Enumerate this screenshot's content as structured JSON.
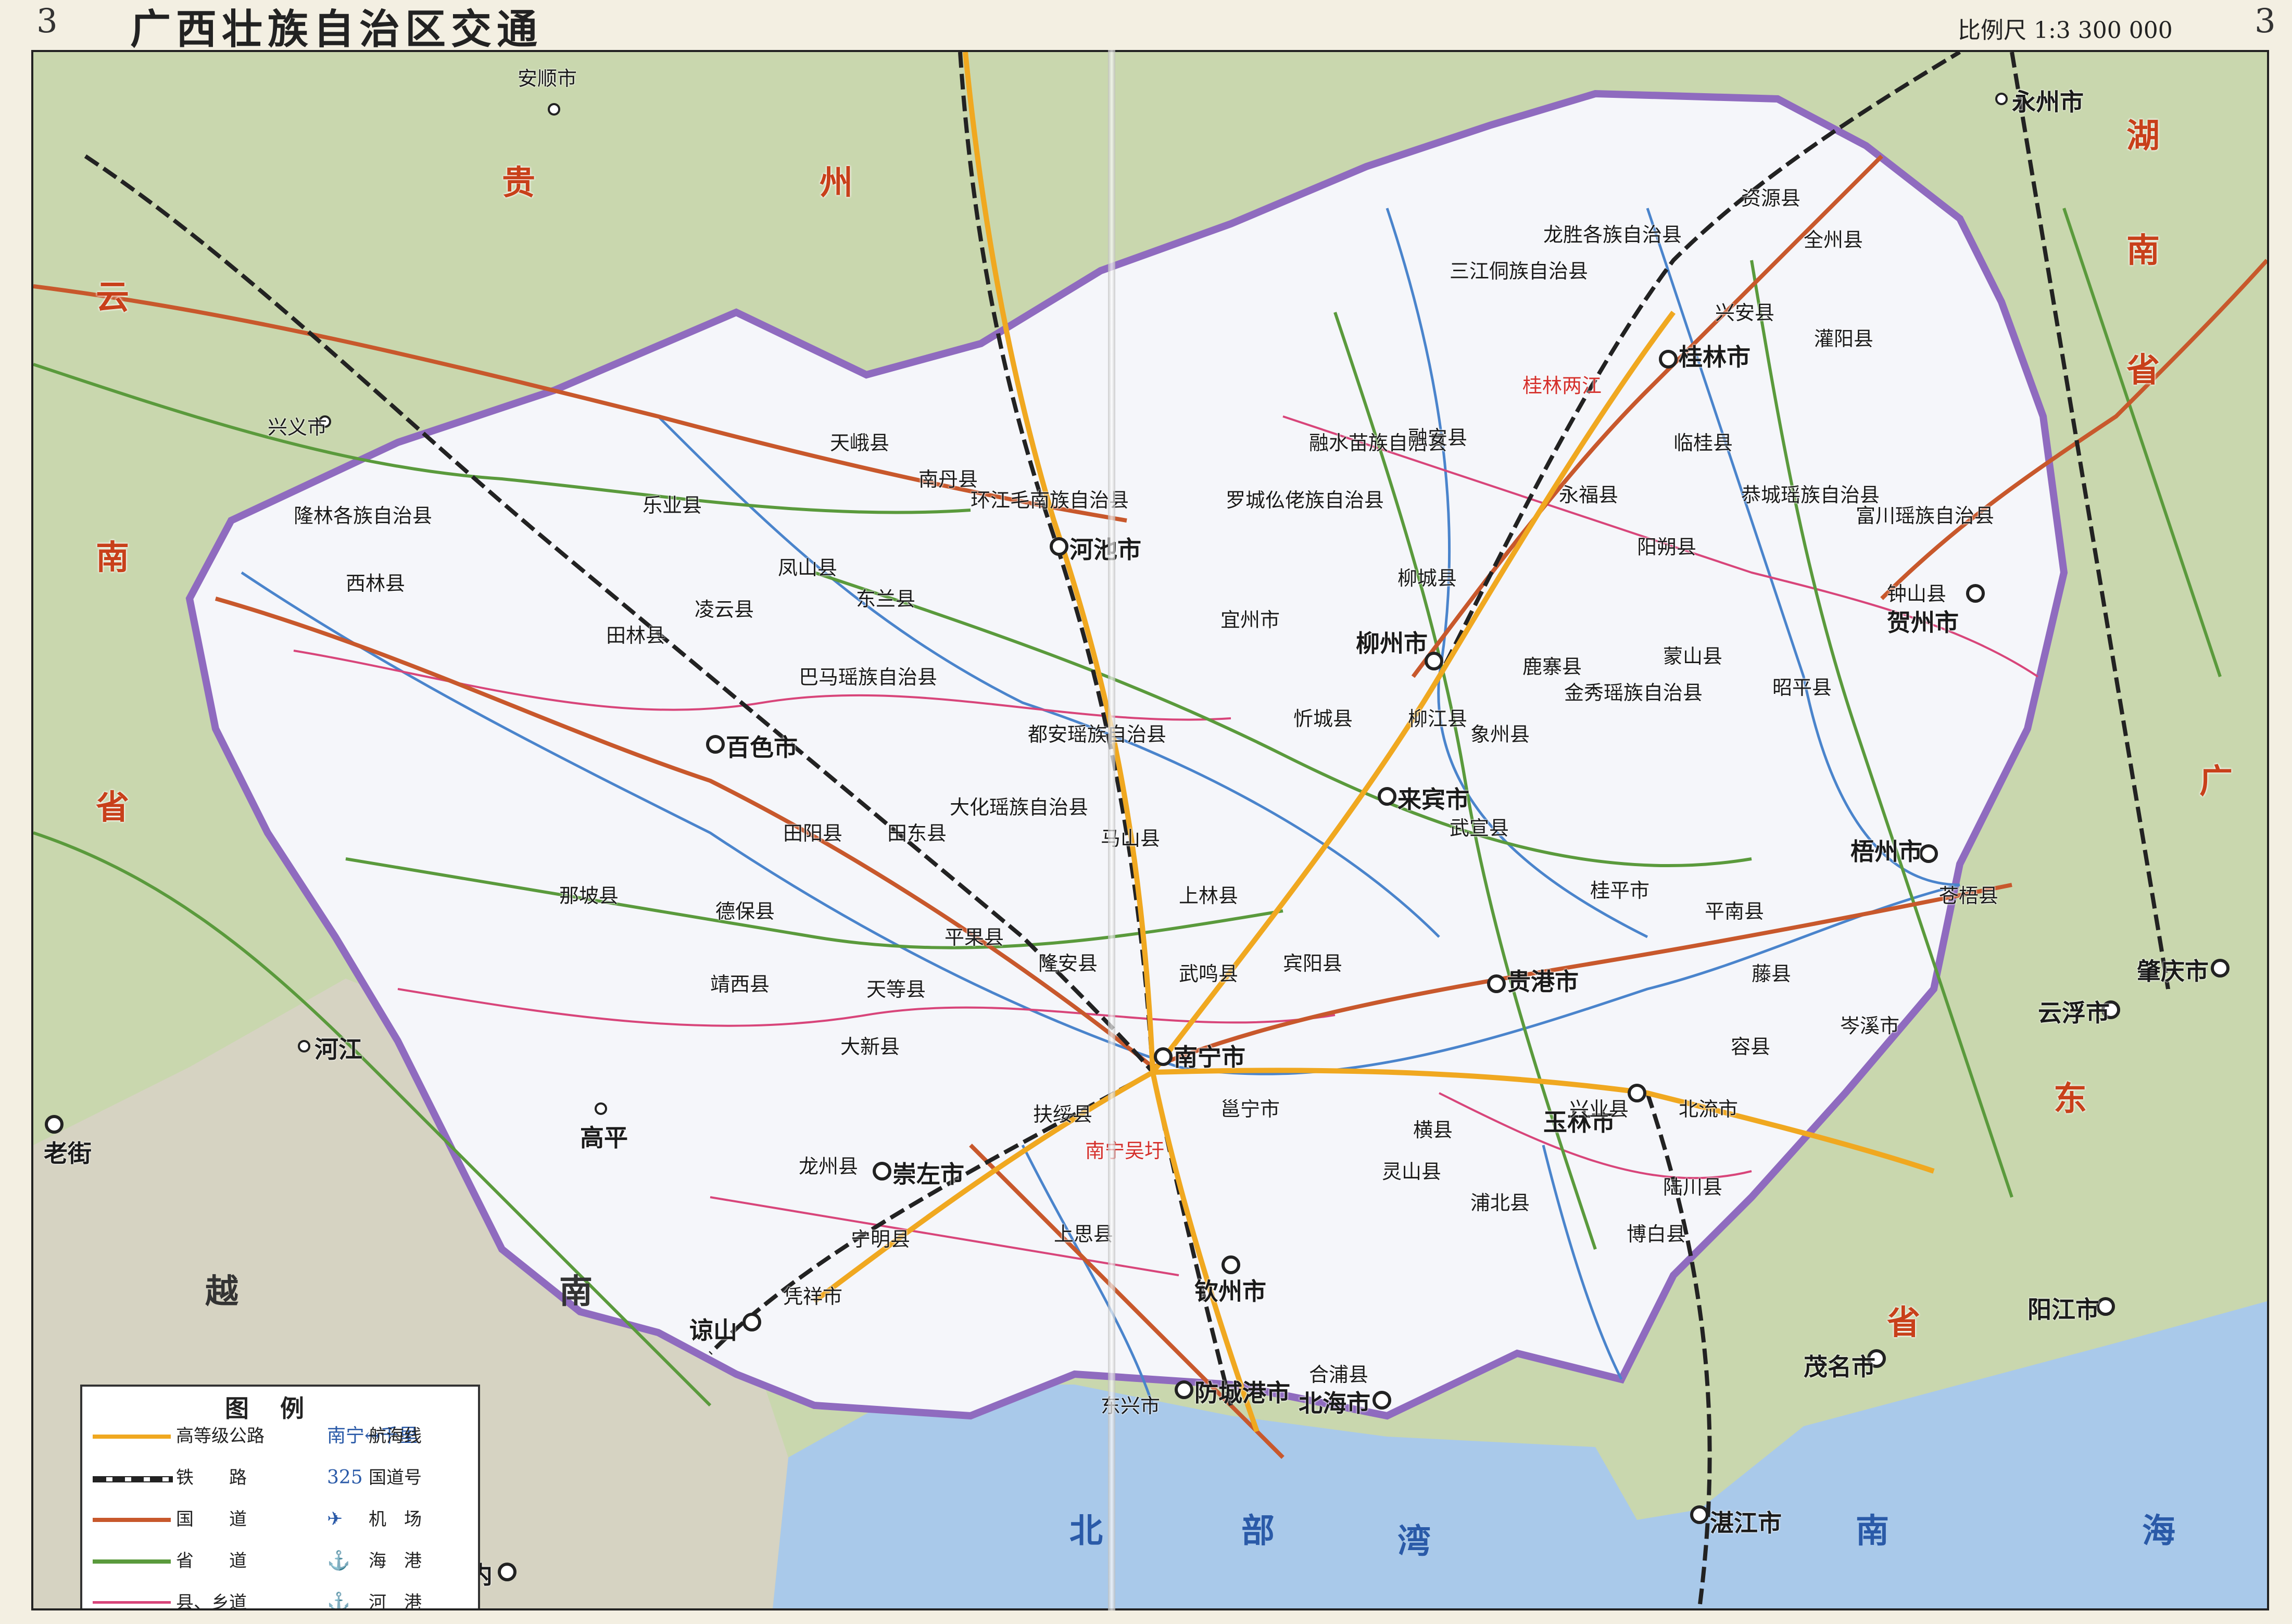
{
  "header": {
    "page_num_left": "3",
    "page_num_right": "3",
    "title": "广西壮族自治区交通",
    "scale": "比例尺 1:3 300 000"
  },
  "colors": {
    "land_outside": "#c9d7ae",
    "guangxi_fill": "#f5f6fa",
    "border": "#8f6bbf",
    "sea": "#a9c9ea",
    "national_road": "#c8582c",
    "provincial_road": "#5a9a3c",
    "county_road": "#d8457a",
    "railway": "#222222",
    "expressway": "#f0a820",
    "river": "#4a84cc"
  },
  "map": {
    "regions": [
      "贵",
      "州",
      "云",
      "南",
      "省",
      "湖",
      "南",
      "省",
      "广",
      "东",
      "省",
      "越",
      "南"
    ],
    "seas": [
      "北",
      "部",
      "湾",
      "南",
      "海"
    ],
    "cities": [
      "南宁市",
      "柳州市",
      "桂林市",
      "梧州市",
      "北海市",
      "防城港市",
      "钦州市",
      "贵港市",
      "玉林市",
      "百色市",
      "贺州市",
      "河池市",
      "来宾市",
      "崇左市"
    ],
    "outside_cities": [
      "安顺市",
      "兴义市",
      "永州市",
      "湛江市",
      "茂名市",
      "阳江市",
      "肇庆市",
      "云浮市",
      "河内",
      "谅山",
      "老街",
      "河江",
      "高平"
    ],
    "counties": [
      "隆林各族自治县",
      "西林县",
      "田林县",
      "乐业县",
      "凌云县",
      "凤山县",
      "东兰县",
      "巴马瑶族自治县",
      "天峨县",
      "南丹县",
      "环江毛南族自治县",
      "罗城仫佬族自治县",
      "融水苗族自治县",
      "三江侗族自治县",
      "龙胜各族自治县",
      "资源县",
      "全州县",
      "兴安县",
      "灌阳县",
      "恭城瑶族自治县",
      "阳朔县",
      "临桂县",
      "永福县",
      "富川瑶族自治县",
      "钟山县",
      "昭平县",
      "蒙山县",
      "金秀瑶族自治县",
      "象州县",
      "武宣县",
      "忻城县",
      "宜州市",
      "都安瑶族自治县",
      "大化瑶族自治县",
      "马山县",
      "上林县",
      "宾阳县",
      "横县",
      "平南县",
      "桂平市",
      "藤县",
      "岑溪市",
      "容县",
      "北流市",
      "陆川县",
      "博白县",
      "兴业县",
      "浦北县",
      "灵山县",
      "合浦县",
      "东兴市",
      "上思县",
      "宁明县",
      "凭祥市",
      "龙州县",
      "大新县",
      "天等县",
      "靖西县",
      "德保县",
      "那坡县",
      "田阳县",
      "田东县",
      "平果县",
      "隆安县",
      "扶绥县",
      "邕宁市",
      "武鸣县",
      "鹿寨县",
      "融安县",
      "柳城县",
      "柳江县",
      "苍梧县"
    ],
    "airports": [
      "桂林两江",
      "南宁吴圩"
    ]
  },
  "legend": {
    "title": "图例",
    "rows": [
      {
        "left": "高等级公路",
        "right": "航海线",
        "right_sym": "南宁↔千里"
      },
      {
        "left": "铁　　路",
        "right": "国道号",
        "right_sym": "325"
      },
      {
        "left": "国　　道",
        "right": "机　场",
        "right_sym": "✈"
      },
      {
        "left": "省　　道",
        "right": "海　港",
        "right_sym": "⚓"
      },
      {
        "left": "县、乡道",
        "right": "河　港",
        "right_sym": "⚓"
      }
    ]
  }
}
